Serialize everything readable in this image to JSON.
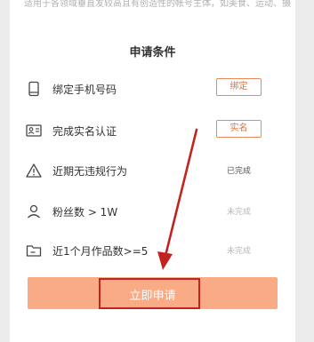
{
  "intro_text": "适用于各领域垂直发较高且有创造性的帐号主体，如美食、运动、摄影等领域创作者",
  "section_title": "申请条件",
  "conditions": [
    {
      "icon": "phone-icon",
      "label": "绑定手机号码",
      "action": "绑定",
      "type": "button"
    },
    {
      "icon": "id-card-icon",
      "label": "完成实名认证",
      "action": "实名",
      "type": "button"
    },
    {
      "icon": "warning-icon",
      "label": "近期无违规行为",
      "action": "已完成",
      "type": "status-done"
    },
    {
      "icon": "user-icon",
      "label": "粉丝数 > 1W",
      "action": "未完成",
      "type": "status-pending"
    },
    {
      "icon": "folder-icon",
      "label": "近1个月作品数>=5",
      "action": "未完成",
      "type": "status-pending"
    }
  ],
  "apply_button_label": "立即申请",
  "colors": {
    "accent": "#e0703e",
    "apply_bg": "#f9ab85",
    "annotation_red": "#c3231f"
  }
}
